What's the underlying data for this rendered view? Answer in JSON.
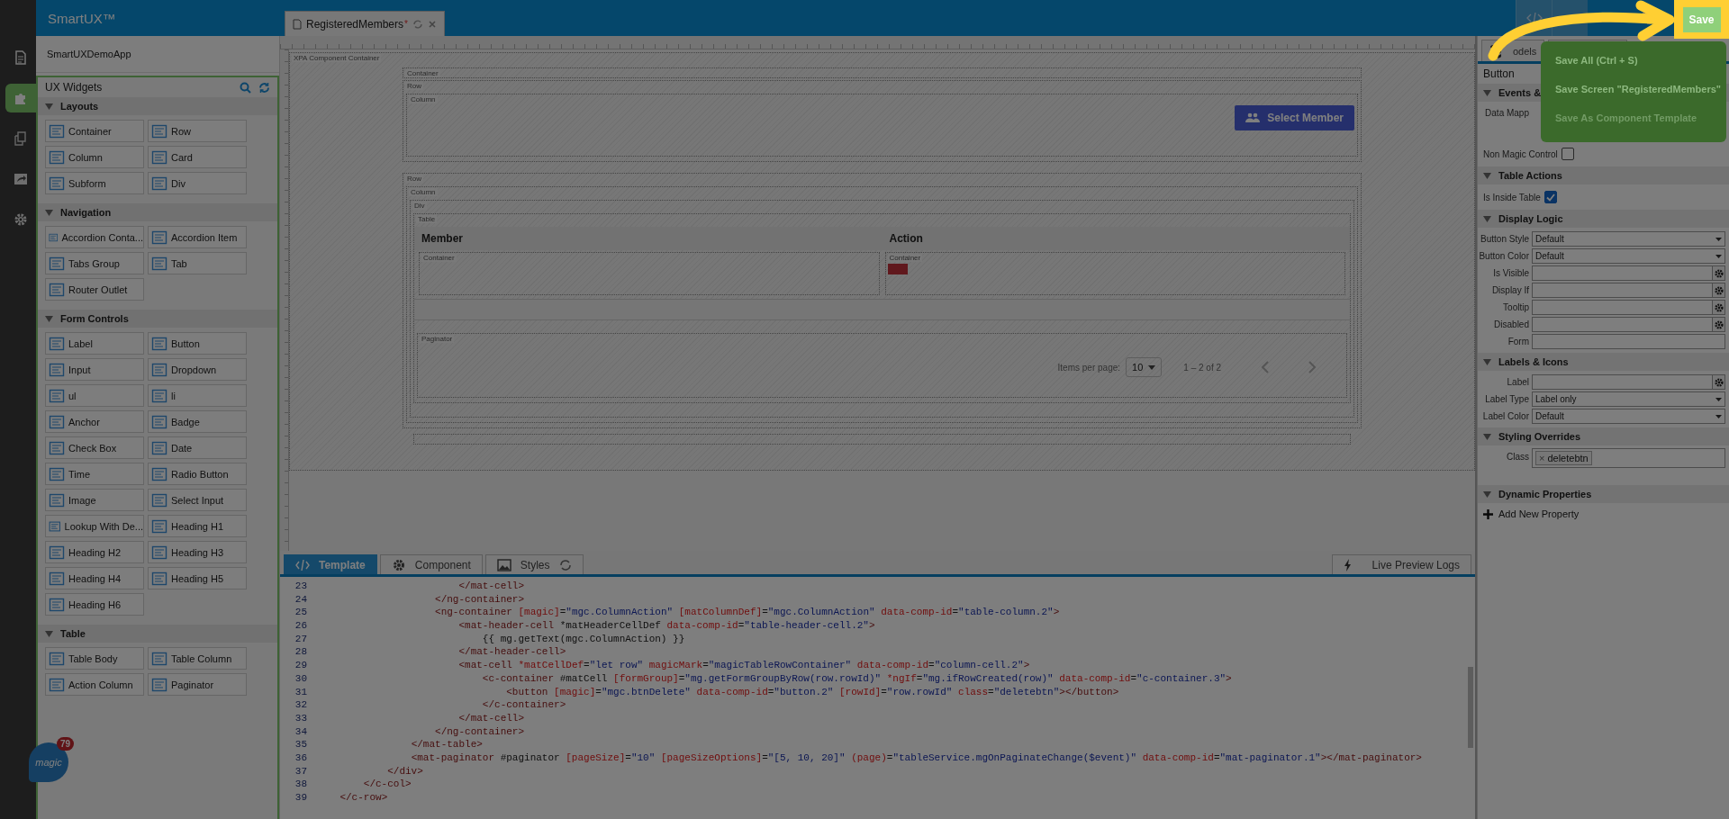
{
  "app": {
    "title": "SmartUX™",
    "project": "SmartUXDemoApp",
    "logo_text": "magic",
    "logo_badge": "79"
  },
  "rail": [
    {
      "kind": "page",
      "selected": false
    },
    {
      "kind": "widgets",
      "selected": true
    },
    {
      "kind": "copy",
      "selected": false
    },
    {
      "kind": "export",
      "selected": false
    },
    {
      "kind": "settings",
      "selected": false
    }
  ],
  "widgets": {
    "title": "UX Widgets",
    "groups": [
      {
        "title": "Layouts",
        "expanded": true,
        "items": [
          "Container",
          "Row",
          "Column",
          "Card",
          "Subform",
          "Div"
        ]
      },
      {
        "title": "Navigation",
        "expanded": true,
        "items": [
          "Accordion Conta...",
          "Accordion Item",
          "Tabs Group",
          "Tab",
          "Router Outlet"
        ]
      },
      {
        "title": "Form Controls",
        "expanded": true,
        "items": [
          "Label",
          "Button",
          "Input",
          "Dropdown",
          "ul",
          "li",
          "Anchor",
          "Badge",
          "Check Box",
          "Date",
          "Time",
          "Radio Button",
          "Image",
          "Select Input",
          "Lookup With De...",
          "Heading H1",
          "Heading H2",
          "Heading H3",
          "Heading H4",
          "Heading H5",
          "Heading H6"
        ]
      },
      {
        "title": "Table",
        "expanded": true,
        "items": [
          "Table Body",
          "Table Column",
          "Action Column",
          "Paginator"
        ]
      }
    ]
  },
  "editor_tab": {
    "label": "RegisteredMembers",
    "modified_mark": "*",
    "selected": true
  },
  "canvas": {
    "root_label": "XPA Component Container",
    "container_label": "Container",
    "row_label": "Row",
    "column_label": "Column",
    "select_button": "Select Member",
    "row2_label": "Row",
    "column2_label": "Column",
    "div_label": "Div",
    "table_label": "Table",
    "columns": [
      {
        "header": "Member",
        "cell_label": "Container",
        "has_button": false
      },
      {
        "header": "Action",
        "cell_label": "Container",
        "has_button": true
      }
    ],
    "paginator": {
      "label": "Paginator",
      "items_per_page": "Items per page:",
      "page_size": "10",
      "range": "1 – 2 of 2"
    }
  },
  "bottom_tabs": [
    {
      "label": "Template",
      "kind": "code",
      "selected": true
    },
    {
      "label": "Component",
      "kind": "gear",
      "selected": false
    },
    {
      "label": "Styles",
      "kind": "image",
      "selected": false
    }
  ],
  "logs_button": "Live Preview Logs",
  "code": [
    {
      "number": "23",
      "text": "                        </mat-cell>"
    },
    {
      "number": "24",
      "text": "                    </ng-container>"
    },
    {
      "number": "25",
      "text": "                    <ng-container [magic]=\"mgc.ColumnAction\" [matColumnDef]=\"mgc.ColumnAction\" data-comp-id=\"table-column.2\">"
    },
    {
      "number": "26",
      "text": "                        <mat-header-cell *matHeaderCellDef data-comp-id=\"table-header-cell.2\">"
    },
    {
      "number": "27",
      "text": "                            {{ mg.getText(mgc.ColumnAction) }}"
    },
    {
      "number": "28",
      "text": "                        </mat-header-cell>"
    },
    {
      "number": "29",
      "text": "                        <mat-cell *matCellDef=\"let row\" magicMark=\"magicTableRowContainer\" data-comp-id=\"column-cell.2\">"
    },
    {
      "number": "30",
      "text": "                            <c-container #matCell [formGroup]=\"mg.getFormGroupByRow(row.rowId)\" *ngIf=\"mg.ifRowCreated(row)\" data-comp-id=\"c-container.3\">"
    },
    {
      "number": "31",
      "text": "                                <button [magic]=\"mgc.btnDelete\" data-comp-id=\"button.2\" [rowId]=\"row.rowId\" class=\"deletebtn\"></button>"
    },
    {
      "number": "32",
      "text": "                            </c-container>"
    },
    {
      "number": "33",
      "text": "                        </mat-cell>"
    },
    {
      "number": "34",
      "text": "                    </ng-container>"
    },
    {
      "number": "35",
      "text": "                </mat-table>"
    },
    {
      "number": "36",
      "text": "                <mat-paginator #paginator [pageSize]=\"10\" [pageSizeOptions]=\"[5, 10, 20]\" (page)=\"tableService.mgOnPaginateChange($event)\" data-comp-id=\"mat-paginator.1\"></mat-paginator>"
    },
    {
      "number": "37",
      "text": "            </div>"
    },
    {
      "number": "38",
      "text": "        </c-col>"
    },
    {
      "number": "39",
      "text": "    </c-row>"
    }
  ],
  "properties": {
    "tab": "odels",
    "header": "Button",
    "sections": [
      {
        "title": "Events &",
        "rows": [
          {
            "kind": "label",
            "label": "Data Mapp"
          },
          {
            "kind": "checkbox",
            "label": "Non Magic Control",
            "checked": false
          }
        ]
      },
      {
        "title": "Table Actions",
        "rows": [
          {
            "kind": "checkbox",
            "label": "Is Inside Table",
            "checked": true
          }
        ]
      },
      {
        "title": "Display Logic",
        "rows": [
          {
            "kind": "select",
            "label": "Button Style",
            "value": "Default"
          },
          {
            "kind": "select",
            "label": "Button Color",
            "value": "Default"
          },
          {
            "kind": "expr",
            "label": "Is Visible"
          },
          {
            "kind": "expr",
            "label": "Display If"
          },
          {
            "kind": "expr",
            "label": "Tooltip"
          },
          {
            "kind": "expr",
            "label": "Disabled"
          },
          {
            "kind": "text",
            "label": "Form"
          }
        ]
      },
      {
        "title": "Labels & Icons",
        "rows": [
          {
            "kind": "expr",
            "label": "Label"
          },
          {
            "kind": "select",
            "label": "Label Type",
            "value": "Label only"
          },
          {
            "kind": "select",
            "label": "Label Color",
            "value": "Default"
          }
        ]
      },
      {
        "title": "Styling Overrides",
        "rows": [
          {
            "kind": "tags",
            "label": "Class",
            "remove_mark": "×",
            "tags": [
              "deletebtn"
            ]
          }
        ]
      },
      {
        "title": "Dynamic Properties",
        "rows": [
          {
            "kind": "add",
            "label": "Add New Property"
          }
        ]
      }
    ]
  },
  "save_button": "Save",
  "save_menu": [
    {
      "label": "Save All (Ctrl + S)",
      "disabled": false
    },
    {
      "label": "Save Screen \"RegisteredMembers\"",
      "disabled": false
    },
    {
      "label": "Save As Component Template",
      "disabled": true
    }
  ]
}
